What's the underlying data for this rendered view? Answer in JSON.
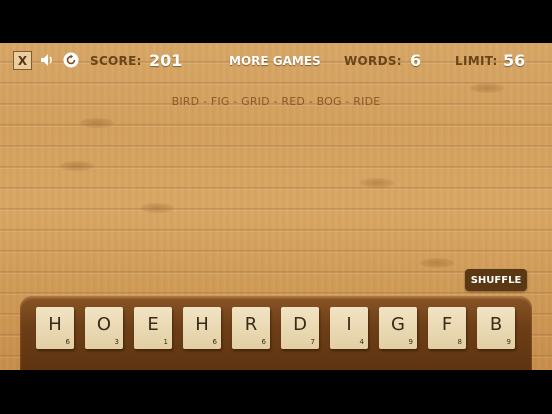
{
  "hud": {
    "close_label": "X",
    "score_label": "SCORE:",
    "score_value": "201",
    "more_games_label": "MORE GAMES",
    "words_label": "WORDS:",
    "words_value": "6",
    "limit_label": "LIMIT:",
    "limit_value": "56",
    "icons": [
      "speaker-icon",
      "restart-icon"
    ]
  },
  "found_words": "BIRD - FIG - GRID - RED - BOG - RIDE",
  "shuffle_label": "SHUFFLE",
  "tiles": [
    {
      "letter": "H",
      "points": "6"
    },
    {
      "letter": "O",
      "points": "3"
    },
    {
      "letter": "E",
      "points": "1"
    },
    {
      "letter": "H",
      "points": "6"
    },
    {
      "letter": "R",
      "points": "6"
    },
    {
      "letter": "D",
      "points": "7"
    },
    {
      "letter": "I",
      "points": "4"
    },
    {
      "letter": "G",
      "points": "9"
    },
    {
      "letter": "F",
      "points": "8"
    },
    {
      "letter": "B",
      "points": "9"
    }
  ]
}
